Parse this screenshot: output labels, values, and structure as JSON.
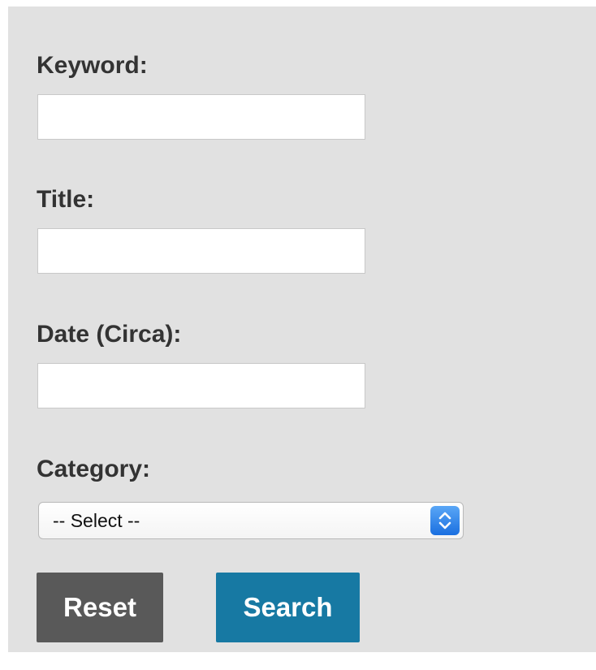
{
  "form": {
    "keyword": {
      "label": "Keyword:",
      "value": "",
      "placeholder": ""
    },
    "title": {
      "label": "Title:",
      "value": "",
      "placeholder": ""
    },
    "date": {
      "label": "Date (Circa):",
      "value": "",
      "placeholder": ""
    },
    "category": {
      "label": "Category:",
      "selected": "-- Select --",
      "arrow_icon": "up-down-chevron-icon"
    },
    "buttons": {
      "reset_label": "Reset",
      "search_label": "Search"
    }
  },
  "colors": {
    "panel_bg": "#e1e1e1",
    "label_text": "#333333",
    "reset_bg": "#595959",
    "search_bg": "#1779a3",
    "select_arrow_accent": "#1a6fe0"
  }
}
